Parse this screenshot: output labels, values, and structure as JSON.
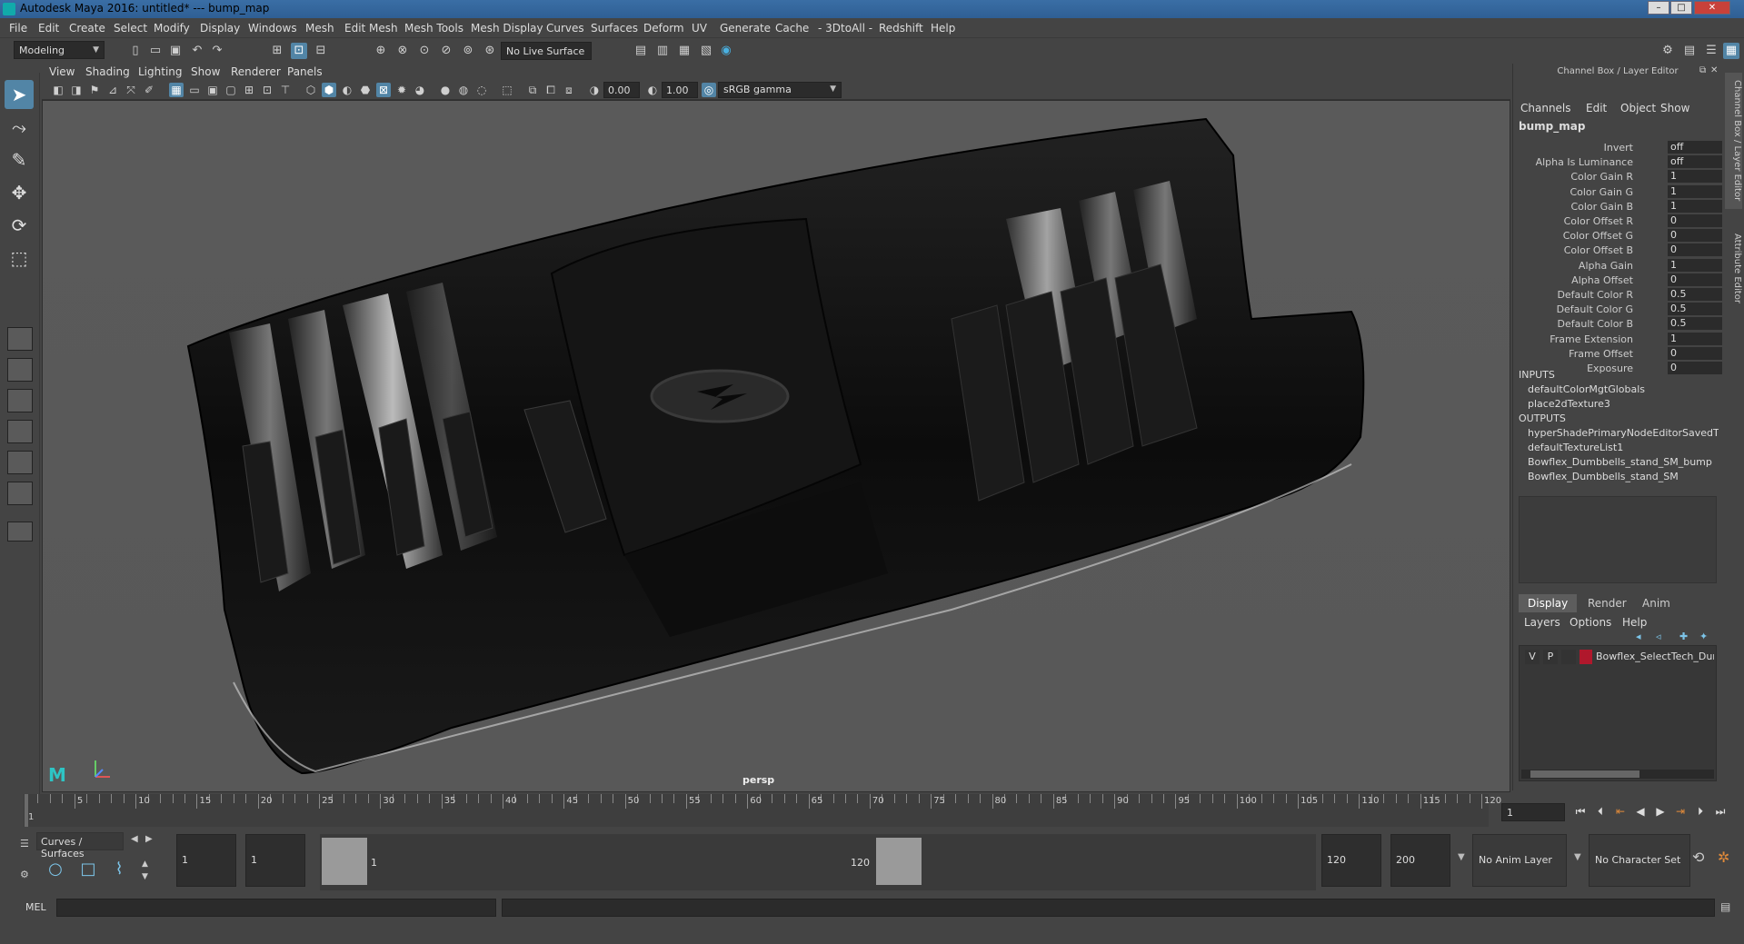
{
  "window": {
    "title": "Autodesk Maya 2016: untitled*   ---   bump_map",
    "minimize": "–",
    "maximize": "□",
    "close": "✕"
  },
  "menubar": [
    "File",
    "Edit",
    "Create",
    "Select",
    "Modify",
    "Display",
    "Windows",
    "Mesh",
    "Edit Mesh",
    "Mesh Tools",
    "Mesh Display",
    "Curves",
    "Surfaces",
    "Deform",
    "UV",
    "Generate",
    "Cache",
    "- 3DtoAll -",
    "Redshift",
    "Help"
  ],
  "statusline": {
    "mode": "Modeling",
    "live_surface": "No Live Surface"
  },
  "panel_menu": [
    "View",
    "Shading",
    "Lighting",
    "Show",
    "Renderer",
    "Panels"
  ],
  "panel_toolbar": {
    "exposure": "0.00",
    "gamma": "1.00",
    "colorspace": "sRGB gamma"
  },
  "viewport": {
    "camera_label": "persp"
  },
  "channel_box": {
    "title": "Channel Box / Layer Editor",
    "menu": [
      "Channels",
      "Edit",
      "Object",
      "Show"
    ],
    "node_name": "bump_map",
    "attributes": [
      {
        "name": "Invert",
        "value": "off"
      },
      {
        "name": "Alpha Is Luminance",
        "value": "off"
      },
      {
        "name": "Color Gain R",
        "value": "1"
      },
      {
        "name": "Color Gain G",
        "value": "1"
      },
      {
        "name": "Color Gain B",
        "value": "1"
      },
      {
        "name": "Color Offset R",
        "value": "0"
      },
      {
        "name": "Color Offset G",
        "value": "0"
      },
      {
        "name": "Color Offset B",
        "value": "0"
      },
      {
        "name": "Alpha Gain",
        "value": "1"
      },
      {
        "name": "Alpha Offset",
        "value": "0"
      },
      {
        "name": "Default Color R",
        "value": "0.5"
      },
      {
        "name": "Default Color G",
        "value": "0.5"
      },
      {
        "name": "Default Color B",
        "value": "0.5"
      },
      {
        "name": "Frame Extension",
        "value": "1"
      },
      {
        "name": "Frame Offset",
        "value": "0"
      },
      {
        "name": "Exposure",
        "value": "0"
      }
    ],
    "inputs_label": "INPUTS",
    "inputs": [
      "defaultColorMgtGlobals",
      "place2dTexture3"
    ],
    "outputs_label": "OUTPUTS",
    "outputs": [
      "hyperShadePrimaryNodeEditorSavedT...",
      "defaultTextureList1",
      "Bowflex_Dumbbells_stand_SM_bump",
      "Bowflex_Dumbbells_stand_SM"
    ]
  },
  "layer_editor": {
    "tabs": [
      "Display",
      "Render",
      "Anim"
    ],
    "active_tab": "Display",
    "menu": [
      "Layers",
      "Options",
      "Help"
    ],
    "layer": {
      "visible": "V",
      "playback": "P",
      "name": "Bowflex_SelectTech_Dum",
      "color": "#b0182c"
    }
  },
  "side_tabs": [
    "Channel Box / Layer Editor",
    "Attribute Editor"
  ],
  "time_slider": {
    "tick_labels": [
      "1",
      "5",
      "10",
      "15",
      "20",
      "25",
      "30",
      "35",
      "40",
      "45",
      "50",
      "55",
      "60",
      "65",
      "70",
      "75",
      "80",
      "85",
      "90",
      "95",
      "100",
      "105",
      "110",
      "115",
      "120"
    ],
    "current_frame": "1"
  },
  "range_slider": {
    "shelf_name": "Curves / Surfaces",
    "start_time": "1",
    "playback_start": "1",
    "range_start_label": "1",
    "range_end_label": "120",
    "playback_end": "120",
    "end_time": "200",
    "anim_layer": "No Anim Layer",
    "character_set": "No Character Set"
  },
  "command_line": {
    "label": "MEL"
  }
}
